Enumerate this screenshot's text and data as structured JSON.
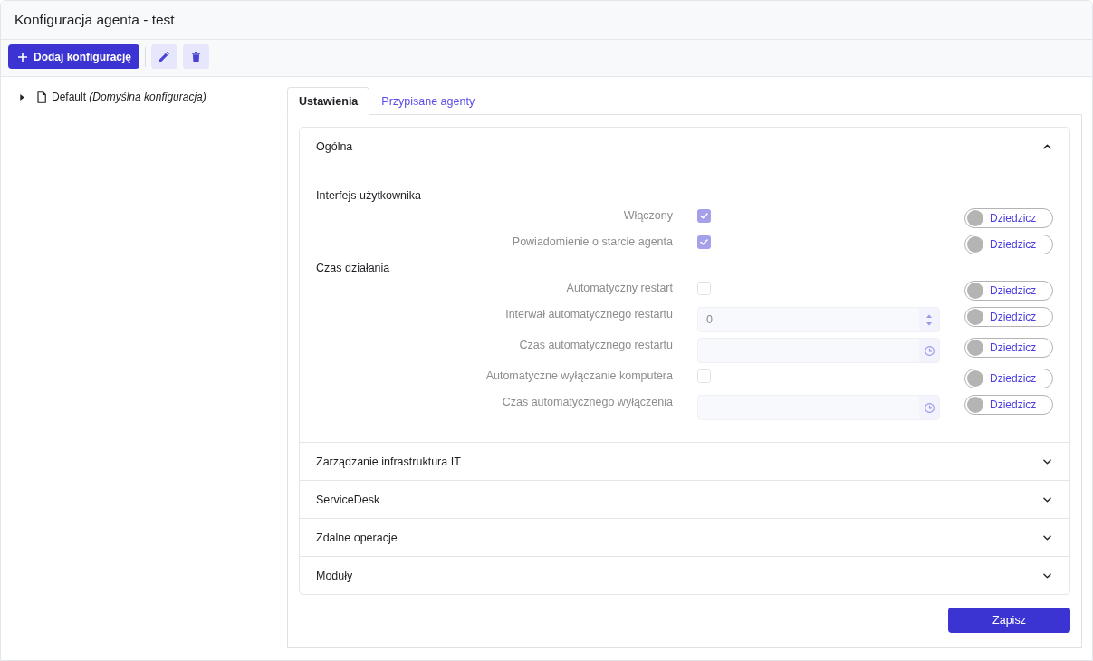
{
  "header": {
    "title": "Konfiguracja agenta - test"
  },
  "toolbar": {
    "add_button": {
      "label": "Dodaj konfigurację"
    }
  },
  "tree": {
    "items": [
      {
        "label": "Default *(Domyślna konfiguracja)*",
        "expanded": false,
        "selected": false
      }
    ]
  },
  "tabs": [
    {
      "label": "Ustawienia",
      "selected": true
    },
    {
      "label": "Przypisane agenty",
      "selected": false
    }
  ],
  "sections": [
    {
      "title": "Ogólna",
      "expanded": true,
      "groups": [
        {
          "title": "Interfejs użytkownika",
          "rows": [
            {
              "label": "Włączony",
              "kind": "checkbox",
              "checked": true,
              "disabled": true,
              "inherit": {
                "label": "Dziedzicz",
                "on": false
              }
            },
            {
              "label": "Powiadomienie o starcie agenta",
              "kind": "checkbox",
              "checked": true,
              "disabled": true,
              "inherit": {
                "label": "Dziedzicz",
                "on": false
              }
            }
          ]
        },
        {
          "title": "Czas działania",
          "rows": [
            {
              "label": "Automatyczny restart",
              "kind": "checkbox",
              "checked": false,
              "disabled": true,
              "inherit": {
                "label": "Dziedzicz",
                "on": false
              }
            },
            {
              "label": "Interwał automatycznego restartu",
              "kind": "number",
              "value": "0",
              "disabled": true,
              "inherit": {
                "label": "Dziedzicz",
                "on": false
              }
            },
            {
              "label": "Czas automatycznego restartu",
              "kind": "time",
              "disabled": true,
              "inherit": {
                "label": "Dziedzicz",
                "on": false
              }
            },
            {
              "label": "Automatyczne wyłączanie komputera",
              "kind": "checkbox",
              "checked": false,
              "disabled": true,
              "inherit": {
                "label": "Dziedzicz",
                "on": false
              }
            },
            {
              "label": "Czas automatycznego wyłączenia",
              "kind": "time",
              "disabled": true,
              "inherit": {
                "label": "Dziedzicz",
                "on": false
              }
            }
          ]
        }
      ]
    },
    {
      "title": "Zarządzanie infrastruktura IT",
      "expanded": false
    },
    {
      "title": "ServiceDesk",
      "expanded": false
    },
    {
      "title": "Zdalne operacje",
      "expanded": false
    },
    {
      "title": "Moduły",
      "expanded": false
    }
  ],
  "save_button": {
    "label": "Zapisz"
  }
}
